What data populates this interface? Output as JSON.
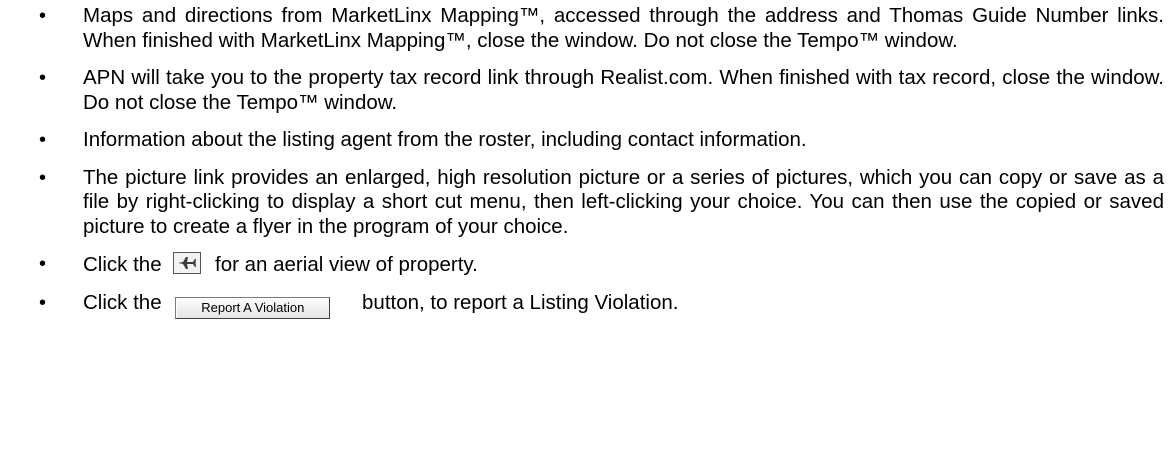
{
  "bullets": [
    {
      "text": "Maps and directions from MarketLinx Mapping™, accessed through the address and Thomas Guide Number links. When finished with MarketLinx Mapping™, close the window.  Do not close the Tempo™ window."
    },
    {
      "text": "APN will take you to the property tax record link through Realist.com. When finished with tax record, close the window. Do not close the Tempo™ window."
    },
    {
      "text": "Information about the listing agent from the roster, including contact information."
    },
    {
      "text": "The picture link provides an enlarged, high resolution picture or a series of pictures, which you can copy or save as a file by right-clicking to display a short cut menu, then left-clicking your choice.  You can then use the copied or saved picture to create a flyer in the program of your choice."
    }
  ],
  "aerial_item": {
    "prefix": "Click the",
    "icon": "airplane-icon",
    "suffix": "for an aerial view of property."
  },
  "report_item": {
    "prefix": "Click the",
    "button_label": "Report A Violation",
    "suffix": "button, to report a Listing Violation."
  },
  "bullet_char": "•"
}
